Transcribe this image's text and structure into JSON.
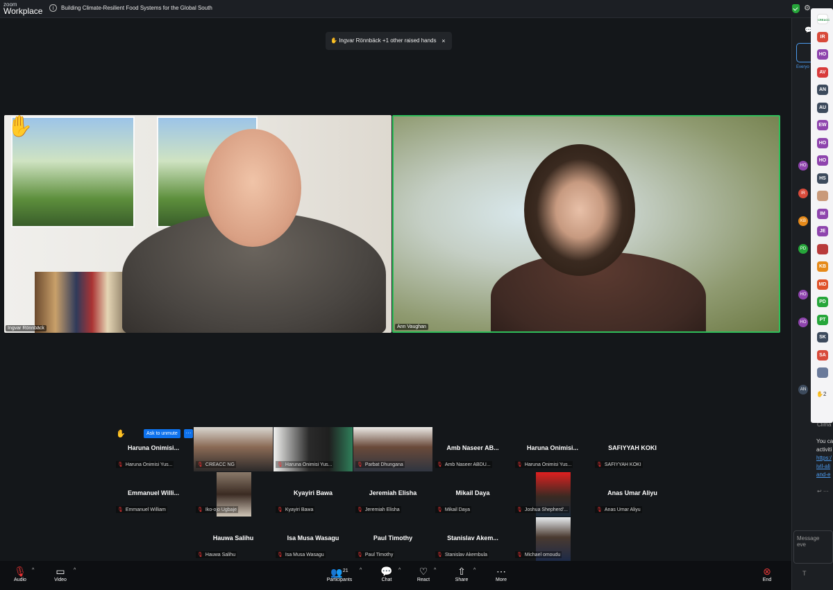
{
  "app": {
    "brand_top": "zoom",
    "brand_bottom": "Workplace"
  },
  "meeting": {
    "title": "Building Climate-Resilient Food Systems for the Global South"
  },
  "notification": {
    "text": "Ingvar Rönnbäck +1 other raised hands",
    "close": "×"
  },
  "speakers": [
    {
      "name": "Ingvar Rönnbäck",
      "hand_raised": true
    },
    {
      "name": "Ann Vaughan",
      "active": true
    }
  ],
  "ask_to_unmute": "Ask to unmute",
  "more_dots": "···",
  "raised_hand_glyph": "✋",
  "gallery": [
    {
      "display": "Haruna  Onimisi...",
      "label": "Haruna Onimisi Yus...",
      "video": false,
      "hand": true
    },
    {
      "display": "",
      "label": "CREACC NG",
      "video": true
    },
    {
      "display": "",
      "label": "Haruna Onimisi Yus...",
      "video": true
    },
    {
      "display": "",
      "label": "Parbat Dhungana",
      "video": true
    },
    {
      "display": "Amb Naseer AB...",
      "label": "Amb Naseer ABDU...",
      "video": false
    },
    {
      "display": "Haruna  Onimisi...",
      "label": "Haruna Onimisi Yus...",
      "video": false
    },
    {
      "display": "SAFIYYAH KOKI",
      "label": "SAFIYYAH KOKI",
      "video": false
    },
    {
      "display": "Emmanuel  Willi...",
      "label": "Emmanuel William",
      "video": false
    },
    {
      "display": "",
      "label": "Iko-ojo Ugbaje",
      "video": true
    },
    {
      "display": "Kyayiri Bawa",
      "label": "Kyayiri Bawa",
      "video": false
    },
    {
      "display": "Jeremiah Elisha",
      "label": "Jeremiah Elisha",
      "video": false
    },
    {
      "display": "Mikail Daya",
      "label": "Mikail Daya",
      "video": false
    },
    {
      "display": "",
      "label": "Joshua Shepherd'...",
      "video": true
    },
    {
      "display": "Anas Umar Aliyu",
      "label": "Anas Umar Aliyu",
      "video": false
    },
    {
      "display": "Hauwa Salihu",
      "label": "Hauwa Salihu",
      "video": false
    },
    {
      "display": "Isa Musa Wasagu",
      "label": "Isa Musa Wasagu",
      "video": false
    },
    {
      "display": "Paul Timothy",
      "label": "Paul Timothy",
      "video": false
    },
    {
      "display": "Stanislav  Akem...",
      "label": "Stanislav Akembula",
      "video": false
    },
    {
      "display": "",
      "label": "Michael omoudu",
      "video": true
    }
  ],
  "toolbar": {
    "audio": "Audio",
    "video": "Video",
    "participants": "Participants",
    "participants_count": "21",
    "chat": "Chat",
    "react": "React",
    "share": "Share",
    "more": "More",
    "end": "End"
  },
  "side_panel": {
    "tab": "Everyo",
    "raised_count": "2",
    "chat_header": "Clima",
    "chat_lines": [
      "You ca",
      "activiti",
      "https:/",
      "ivil-ali",
      "and-e"
    ],
    "message_placeholder": "Message eve",
    "strip_avatars": [
      {
        "initials": "CREACC",
        "color": "#ffffff"
      },
      {
        "initials": "IR",
        "color": "#d84a3a"
      },
      {
        "initials": "HO",
        "color": "#8e44ad"
      },
      {
        "initials": "AV",
        "color": "#d83b3b"
      },
      {
        "initials": "AN",
        "color": "#3c4a5c"
      },
      {
        "initials": "AU",
        "color": "#3c4a5c"
      },
      {
        "initials": "EW",
        "color": "#8e44ad"
      },
      {
        "initials": "HO",
        "color": "#8e44ad"
      },
      {
        "initials": "HO",
        "color": "#8e44ad"
      },
      {
        "initials": "HS",
        "color": "#3c4a5c"
      },
      {
        "initials": "",
        "color": "#c99a7a"
      },
      {
        "initials": "IM",
        "color": "#8e44ad"
      },
      {
        "initials": "JE",
        "color": "#8e44ad"
      },
      {
        "initials": "",
        "color": "#b83a3a"
      },
      {
        "initials": "KB",
        "color": "#e68a1a"
      },
      {
        "initials": "MD",
        "color": "#e0532b"
      },
      {
        "initials": "PD",
        "color": "#26a63a"
      },
      {
        "initials": "PT",
        "color": "#26a63a"
      },
      {
        "initials": "SK",
        "color": "#3c4a5c"
      },
      {
        "initials": "SA",
        "color": "#d84a3a"
      },
      {
        "initials": "",
        "color": "#6a7a9a"
      }
    ],
    "chat_avatars": [
      "HO",
      "IR",
      "KB",
      "PD",
      "HO",
      "HO",
      "AN"
    ]
  }
}
